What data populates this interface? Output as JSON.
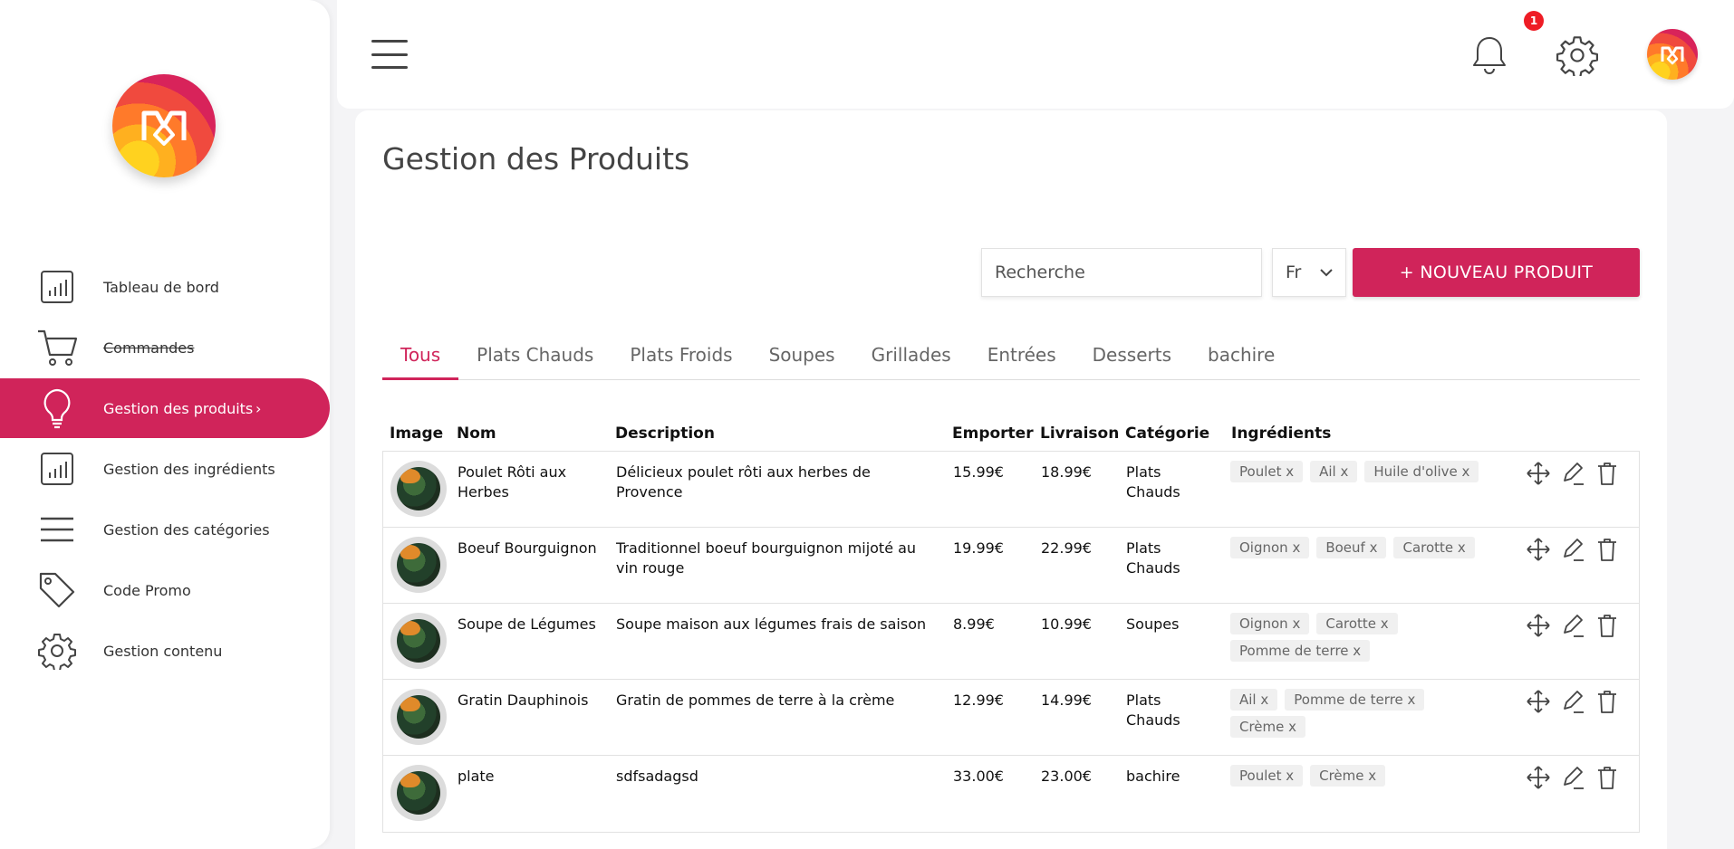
{
  "sidebar": {
    "items": [
      {
        "label": "Tableau de bord",
        "icon": "bar-chart-icon"
      },
      {
        "label": "Commandes",
        "icon": "cart-icon"
      },
      {
        "label": "Gestion des produits",
        "icon": "lightbulb-icon",
        "chevron": "›"
      },
      {
        "label": "Gestion des ingrédients",
        "icon": "bar-chart-icon"
      },
      {
        "label": "Gestion des catégories",
        "icon": "menu-lines-icon"
      },
      {
        "label": "Code Promo",
        "icon": "tag-icon"
      },
      {
        "label": "Gestion contenu",
        "icon": "gear-icon"
      }
    ]
  },
  "topbar": {
    "notification_count": "1"
  },
  "page": {
    "title": "Gestion des Produits",
    "search_placeholder": "Recherche",
    "language": "Fr",
    "new_button": "+ NOUVEAU PRODUIT"
  },
  "tabs": [
    "Tous",
    "Plats Chauds",
    "Plats Froids",
    "Soupes",
    "Grillades",
    "Entrées",
    "Desserts",
    "bachire"
  ],
  "table": {
    "headers": {
      "image": "Image",
      "nom": "Nom",
      "description": "Description",
      "emporter": "Emporter",
      "livraison": "Livraison",
      "categorie": "Catégorie",
      "ingredients": "Ingrédients"
    },
    "rows": [
      {
        "nom": "Poulet Rôti aux Herbes",
        "description": "Délicieux poulet rôti aux herbes de Provence",
        "emporter": "15.99€",
        "livraison": "18.99€",
        "categorie": "Plats Chauds",
        "ingredients": [
          "Poulet x",
          "Ail x",
          "Huile d'olive x"
        ]
      },
      {
        "nom": "Boeuf Bourguignon",
        "description": "Traditionnel boeuf bourguignon mijoté au vin rouge",
        "emporter": "19.99€",
        "livraison": "22.99€",
        "categorie": "Plats Chauds",
        "ingredients": [
          "Oignon x",
          "Boeuf x",
          "Carotte x"
        ]
      },
      {
        "nom": "Soupe de Légumes",
        "description": "Soupe maison aux légumes frais de saison",
        "emporter": "8.99€",
        "livraison": "10.99€",
        "categorie": "Soupes",
        "ingredients": [
          "Oignon x",
          "Carotte x",
          "Pomme de terre x"
        ]
      },
      {
        "nom": "Gratin Dauphinois",
        "description": "Gratin de pommes de terre à la crème",
        "emporter": "12.99€",
        "livraison": "14.99€",
        "categorie": "Plats Chauds",
        "ingredients": [
          "Ail x",
          "Pomme de terre x",
          "Crème x"
        ]
      },
      {
        "nom": "plate",
        "description": "sdfsadagsd",
        "emporter": "33.00€",
        "livraison": "23.00€",
        "categorie": "bachire",
        "ingredients": [
          "Poulet x",
          "Crème x"
        ]
      }
    ]
  },
  "colors": {
    "accent": "#d0245a",
    "badge": "#ee1c25"
  }
}
